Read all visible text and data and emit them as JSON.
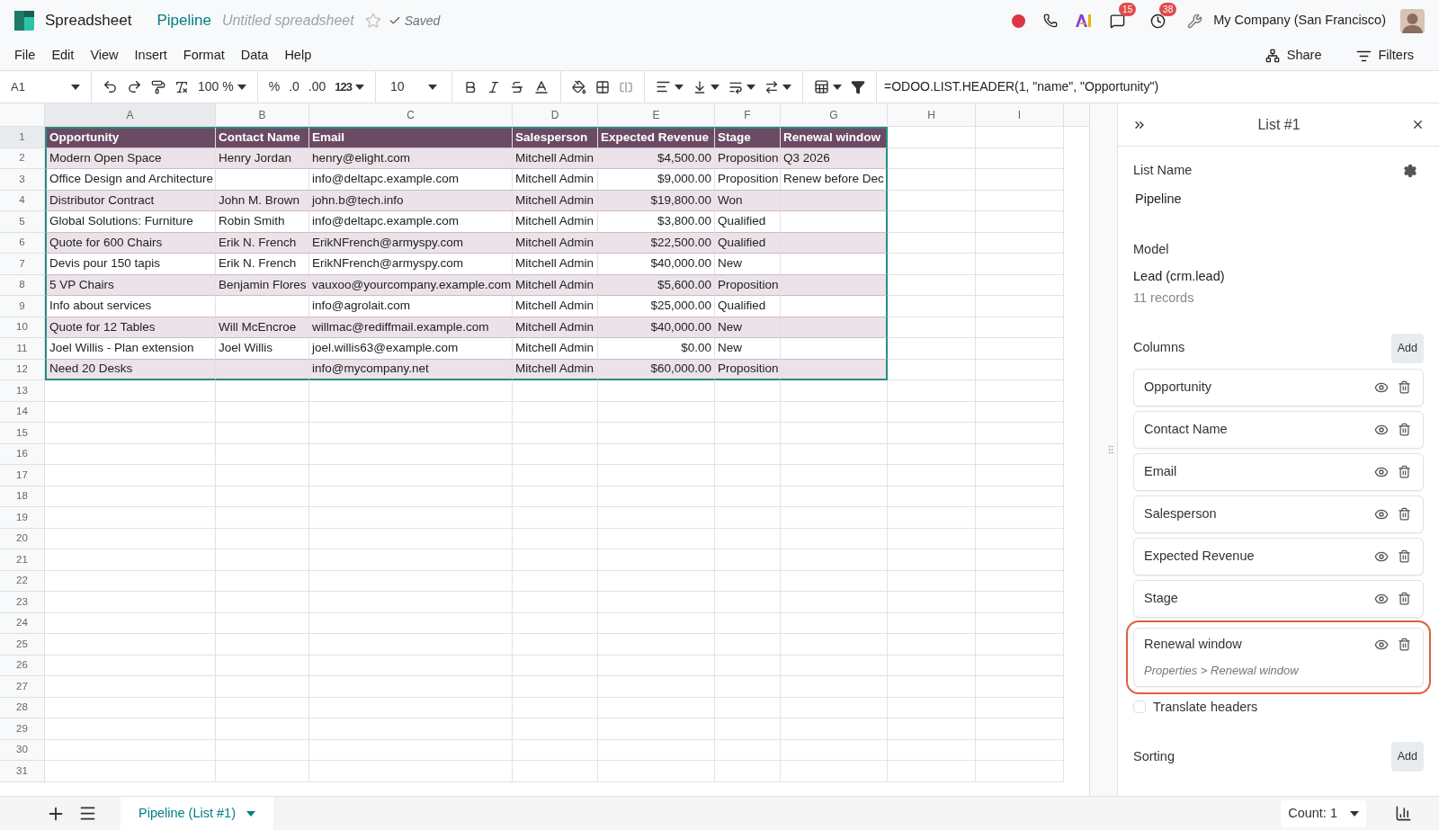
{
  "app": {
    "name": "Spreadsheet",
    "document": "Pipeline",
    "subtitle": "Untitled spreadsheet",
    "status": "Saved",
    "starred": false
  },
  "systray": {
    "messages_badge": "15",
    "activities_badge": "38",
    "company": "My Company (San Francisco)"
  },
  "menu": [
    "File",
    "Edit",
    "View",
    "Insert",
    "Format",
    "Data",
    "Help"
  ],
  "actions": [
    "Share",
    "Filters"
  ],
  "toolbar": {
    "cell_ref": "A1",
    "zoom": "100 %",
    "percent": "%",
    "decimals_less": ".0",
    "decimals_more": ".00",
    "number_format": "123",
    "font_size": "10"
  },
  "formula": "=ODOO.LIST.HEADER(1, \"name\", \"Opportunity\")",
  "sheet": {
    "column_letters": [
      "A",
      "B",
      "C",
      "D",
      "E",
      "F",
      "G",
      "H",
      "I"
    ],
    "row_numbers": [
      "1",
      "2",
      "3",
      "4",
      "5",
      "6",
      "7",
      "8",
      "9",
      "10",
      "11",
      "12",
      "13",
      "14",
      "15",
      "16",
      "17",
      "18",
      "19",
      "20",
      "21",
      "22",
      "23",
      "24",
      "25",
      "26",
      "27",
      "28",
      "29",
      "30",
      "31"
    ],
    "list": {
      "header": [
        {
          "text": "Opportunity",
          "kind": "text"
        },
        {
          "text": "Contact Name",
          "kind": "text"
        },
        {
          "text": "Email",
          "kind": "text"
        },
        {
          "text": "Salesperson",
          "kind": "text"
        },
        {
          "text": "Expected Revenue",
          "kind": "number"
        },
        {
          "text": "Stage",
          "kind": "text"
        },
        {
          "text": "Renewal window",
          "kind": "text"
        }
      ],
      "rows": [
        [
          "Modern Open Space",
          "Henry Jordan",
          "henry@elight.com",
          "Mitchell Admin",
          "$4,500.00",
          "Proposition",
          "Q3 2026"
        ],
        [
          "Office Design and Architecture",
          null,
          "info@deltapc.example.com",
          "Mitchell Admin",
          "$9,000.00",
          "Proposition",
          "Renew before Dec"
        ],
        [
          "Distributor Contract",
          "John M. Brown",
          "john.b@tech.info",
          "Mitchell Admin",
          "$19,800.00",
          "Won",
          null
        ],
        [
          "Global Solutions: Furniture",
          "Robin Smith",
          "info@deltapc.example.com",
          "Mitchell Admin",
          "$3,800.00",
          "Qualified",
          null
        ],
        [
          "Quote for 600 Chairs",
          "Erik N. French",
          "ErikNFrench@armyspy.com",
          "Mitchell Admin",
          "$22,500.00",
          "Qualified",
          null
        ],
        [
          "Devis pour 150 tapis",
          "Erik N. French",
          "ErikNFrench@armyspy.com",
          "Mitchell Admin",
          "$40,000.00",
          "New",
          null
        ],
        [
          "5 VP Chairs",
          "Benjamin Flores",
          "vauxoo@yourcompany.example.com",
          "Mitchell Admin",
          "$5,600.00",
          "Proposition",
          null
        ],
        [
          "Info about services",
          null,
          "info@agrolait.com",
          "Mitchell Admin",
          "$25,000.00",
          "Qualified",
          null
        ],
        [
          "Quote for 12 Tables",
          "Will McEncroe",
          "willmac@rediffmail.example.com",
          "Mitchell Admin",
          "$40,000.00",
          "New",
          null
        ],
        [
          "Joel Willis - Plan extension",
          "Joel Willis",
          "joel.willis63@example.com",
          "Mitchell Admin",
          "$0.00",
          "New",
          null
        ],
        [
          "Need 20 Desks",
          null,
          "info@mycompany.net",
          "Mitchell Admin",
          "$60,000.00",
          "Proposition",
          null
        ]
      ]
    }
  },
  "panel": {
    "title": "List #1",
    "list_name_label": "List Name",
    "list_name": "Pipeline",
    "model_label": "Model",
    "model": "Lead (crm.lead)",
    "records": "11 records",
    "columns_label": "Columns",
    "add": "Add",
    "columns": [
      {
        "label": "Opportunity",
        "highlighted": false
      },
      {
        "label": "Contact Name",
        "highlighted": false
      },
      {
        "label": "Email",
        "highlighted": false
      },
      {
        "label": "Salesperson",
        "highlighted": false
      },
      {
        "label": "Expected Revenue",
        "highlighted": false
      },
      {
        "label": "Stage",
        "highlighted": false
      },
      {
        "label": "Renewal window",
        "highlighted": true,
        "path": "Properties > Renewal window"
      }
    ],
    "translate_headers": {
      "label": "Translate headers",
      "checked": false
    },
    "sorting_label": "Sorting",
    "sorting_add": "Add"
  },
  "bottom": {
    "sheets": [
      {
        "label": "Pipeline (List #1)",
        "selected": true
      }
    ],
    "count": "Count: 1"
  }
}
